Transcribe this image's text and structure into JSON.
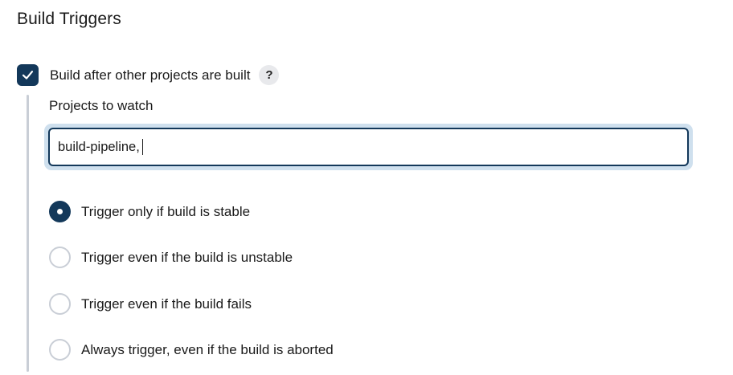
{
  "section": {
    "title": "Build Triggers"
  },
  "trigger": {
    "checkbox_label": "Build after other projects are built",
    "checked": true,
    "help_label": "?"
  },
  "projects": {
    "label": "Projects to watch",
    "value": "build-pipeline,"
  },
  "options": [
    {
      "label": "Trigger only if build is stable",
      "selected": true
    },
    {
      "label": "Trigger even if the build is unstable",
      "selected": false
    },
    {
      "label": "Trigger even if the build fails",
      "selected": false
    },
    {
      "label": "Always trigger, even if the build is aborted",
      "selected": false
    }
  ],
  "colors": {
    "accent": "#13385a",
    "input_focus_ring": "#cfe0ee",
    "divider": "#c9ced6",
    "help_bg": "#e8e9ec"
  }
}
